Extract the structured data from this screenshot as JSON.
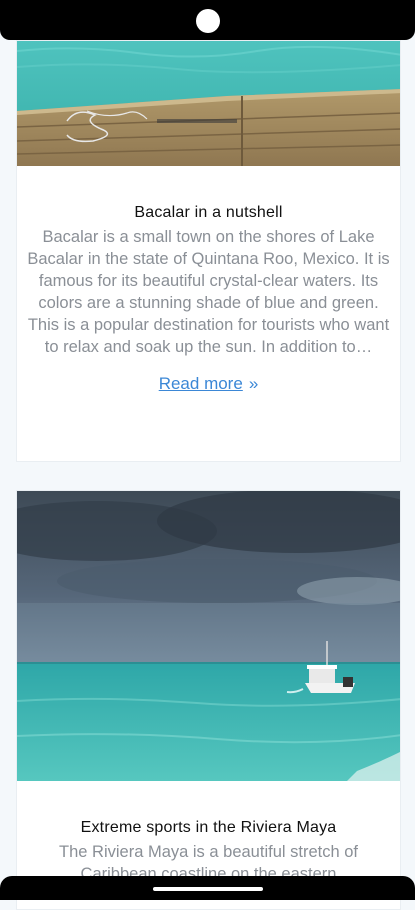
{
  "posts": [
    {
      "title": "Bacalar in a nutshell",
      "excerpt": "Bacalar is a small town on the shores of Lake Bacalar in the state of Quintana Roo, Mexico. It is famous for its beautiful crystal-clear waters. Its colors are a stunning shade of blue and green. This is a popular destination for tourists who want to relax and soak up the sun. In addition to…",
      "read_more": "Read more",
      "read_more_icon": "double-chevron-right-icon",
      "image": "wooden-dock-over-turquoise-lake-photo"
    },
    {
      "title": "Extreme sports in the Riviera Maya",
      "excerpt": "The Riviera Maya is a beautiful stretch of Caribbean coastline on the eastern",
      "image": "boat-on-turquoise-sea-under-stormy-sky-photo"
    }
  ],
  "colors": {
    "link": "#3b87d6",
    "excerpt": "#8a8f96",
    "title": "#111111",
    "background": "#f4f8fb"
  }
}
